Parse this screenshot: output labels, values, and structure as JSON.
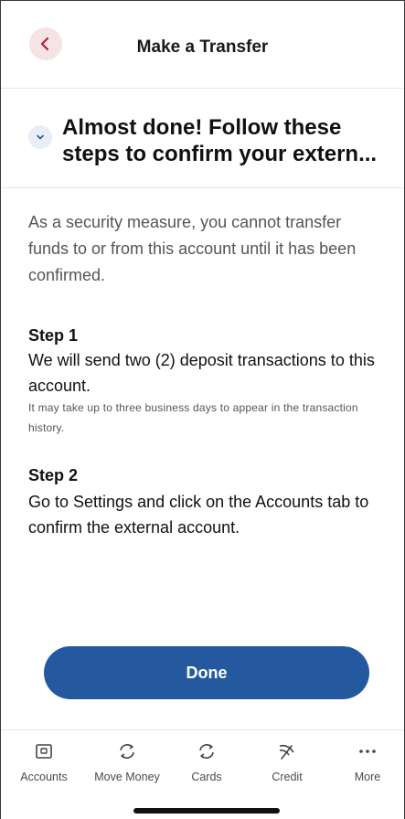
{
  "header": {
    "title": "Make a Transfer",
    "back_icon": "chevron-left-icon"
  },
  "banner": {
    "title": "Almost done! Follow these steps to confirm your extern...",
    "toggle_icon": "chevron-down-icon"
  },
  "intro": "As a security measure, you cannot transfer funds to or from this account until it has been confirmed.",
  "steps": [
    {
      "heading": "Step 1",
      "text": "We will send two (2) deposit transactions to this account.",
      "note": "It may take up to three business days to appear in the transaction history."
    },
    {
      "heading": "Step 2",
      "text": "Go to Settings and click on the Accounts tab to confirm the external account."
    }
  ],
  "done_label": "Done",
  "colors": {
    "accent": "#24599f",
    "back_bg": "#f5e3e6",
    "back_icon": "#b0223a"
  },
  "tabs": [
    {
      "label": "Accounts",
      "icon": "accounts-icon"
    },
    {
      "label": "Move Money",
      "icon": "move-money-icon"
    },
    {
      "label": "Cards",
      "icon": "cards-icon"
    },
    {
      "label": "Credit",
      "icon": "credit-icon"
    },
    {
      "label": "More",
      "icon": "more-icon"
    }
  ]
}
